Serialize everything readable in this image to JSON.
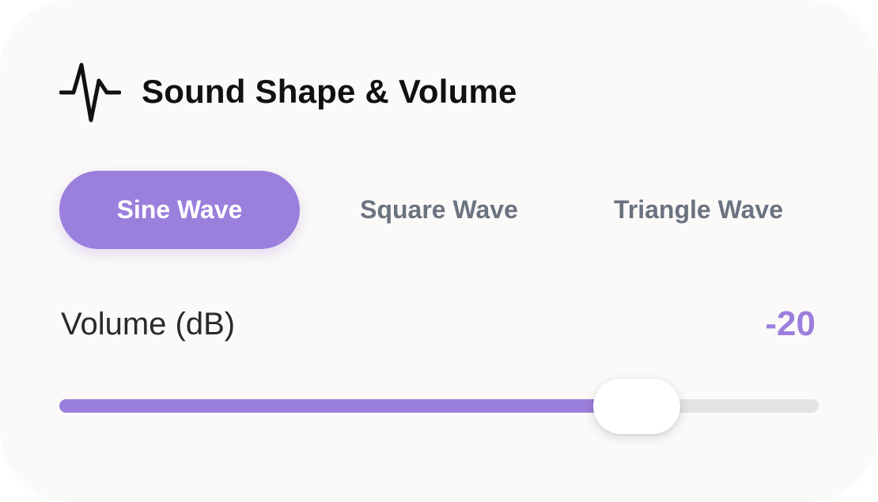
{
  "header": {
    "icon": "waveform-icon",
    "title": "Sound Shape & Volume"
  },
  "tabs": [
    {
      "label": "Sine Wave",
      "selected": true
    },
    {
      "label": "Square Wave",
      "selected": false
    },
    {
      "label": "Triangle Wave",
      "selected": false
    }
  ],
  "volume": {
    "label": "Volume (dB)",
    "value": "-20",
    "slider_fraction": 0.76
  },
  "colors": {
    "accent": "#9b7fdc",
    "track": "#e4e3e1",
    "card_background": "#fbfaf8",
    "inactive_tab_text": "#6b7280"
  }
}
